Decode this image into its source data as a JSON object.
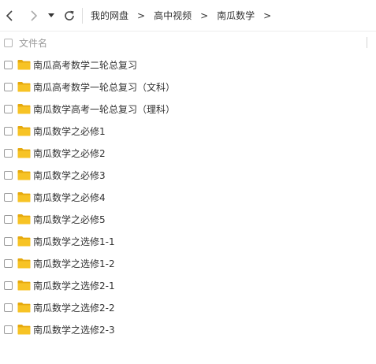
{
  "toolbar": {
    "back_icon": "chevron-left-icon",
    "forward_icon": "chevron-right-icon",
    "dropdown_icon": "triangle-down-icon",
    "refresh_icon": "refresh-icon"
  },
  "breadcrumb": {
    "items": [
      "我的网盘",
      "高中视频",
      "南瓜数学"
    ],
    "separator": ">"
  },
  "header": {
    "name_label": "文件名"
  },
  "files": [
    {
      "name": "南瓜高考数学二轮总复习",
      "type": "folder"
    },
    {
      "name": "南瓜高考数学一轮总复习（文科）",
      "type": "folder"
    },
    {
      "name": "南瓜数学高考一轮总复习（理科）",
      "type": "folder"
    },
    {
      "name": "南瓜数学之必修1",
      "type": "folder"
    },
    {
      "name": "南瓜数学之必修2",
      "type": "folder"
    },
    {
      "name": "南瓜数学之必修3",
      "type": "folder"
    },
    {
      "name": "南瓜数学之必修4",
      "type": "folder"
    },
    {
      "name": "南瓜数学之必修5",
      "type": "folder"
    },
    {
      "name": "南瓜数学之选修1-1",
      "type": "folder"
    },
    {
      "name": "南瓜数学之选修1-2",
      "type": "folder"
    },
    {
      "name": "南瓜数学之选修2-1",
      "type": "folder"
    },
    {
      "name": "南瓜数学之选修2-2",
      "type": "folder"
    },
    {
      "name": "南瓜数学之选修2-3",
      "type": "folder"
    }
  ],
  "colors": {
    "folder": "#f7c325",
    "folder_dark": "#e6a90d",
    "text": "#333333",
    "muted": "#999999"
  }
}
